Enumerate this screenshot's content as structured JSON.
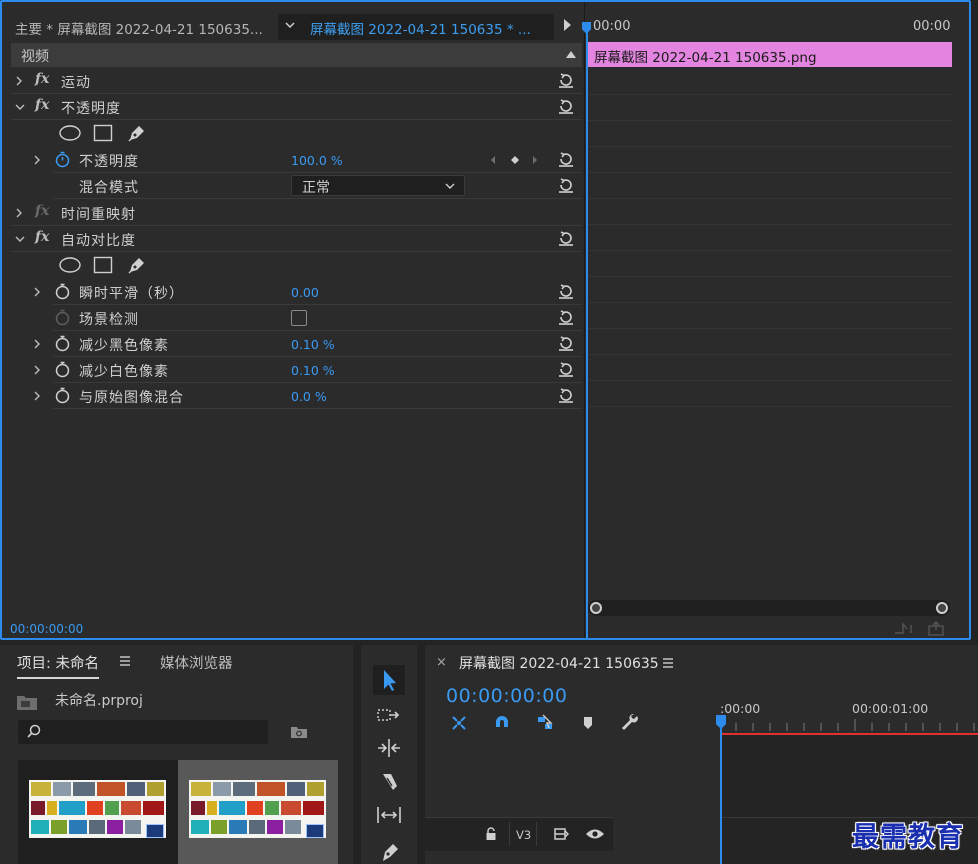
{
  "effect_controls": {
    "source_label": "主要 * 屏幕截图 2022-04-21 150635...",
    "clip_selector": "屏幕截图 2022-04-21 150635 * ...",
    "section_title": "视频",
    "rows": {
      "motion": "运动",
      "opacity": "不透明度",
      "opacity_param": "不透明度",
      "opacity_value": "100.0 %",
      "blend_mode_label": "混合模式",
      "blend_mode_value": "正常",
      "time_remap": "时间重映射",
      "auto_contrast": "自动对比度",
      "temporal_smoothing": "瞬时平滑（秒）",
      "temporal_smoothing_value": "0.00",
      "scene_detect": "场景检测",
      "reduce_black": "减少黑色像素",
      "reduce_black_value": "0.10 %",
      "reduce_white": "减少白色像素",
      "reduce_white_value": "0.10 %",
      "blend_original": "与原始图像混合",
      "blend_original_value": "0.0 %"
    },
    "current_time": "00:00:00:00",
    "ruler_start": "00:00",
    "ruler_end": "00:00",
    "clip_name": "屏幕截图 2022-04-21  150635.png",
    "clip_color": "#e385e0"
  },
  "project": {
    "tab_project": "项目: 未命名",
    "tab_media": "媒体浏览器",
    "project_file": "未命名.prproj",
    "search_placeholder": ""
  },
  "timeline": {
    "sequence_name": "屏幕截图 2022-04-21 150635",
    "timecode": "00:00:00:00",
    "ruler_start": ":00:00",
    "ruler_mark": "00:00:01:00",
    "track_label": "V3"
  },
  "watermark": "最需教育",
  "colors": {
    "accent_blue": "#2d8ceb",
    "value_blue": "#3a9af2",
    "playhead_red": "#e03030"
  }
}
